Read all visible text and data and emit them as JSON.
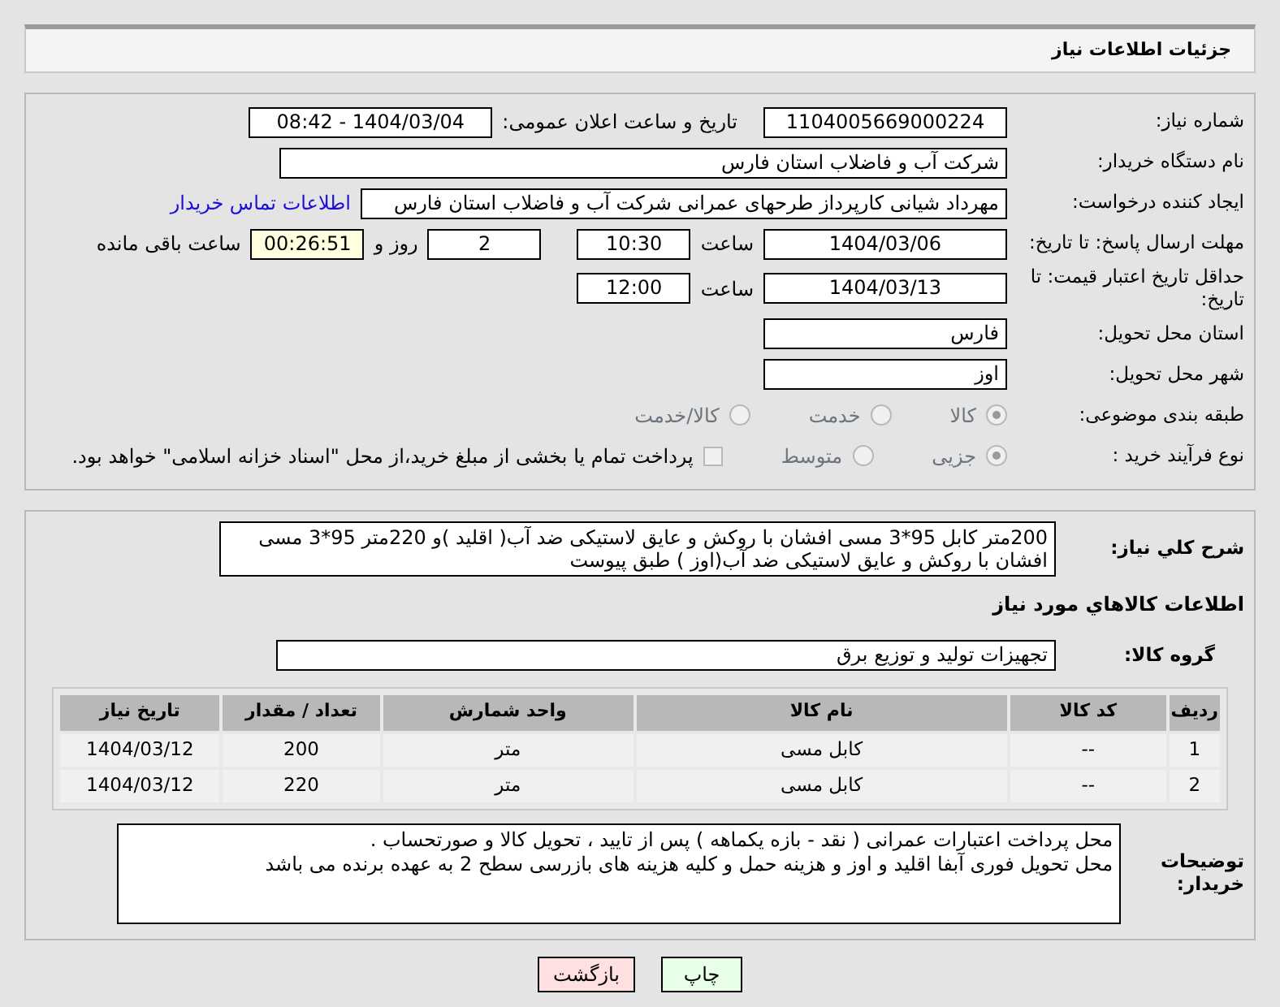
{
  "header": {
    "title": "جزئیات اطلاعات نیاز"
  },
  "need_number": {
    "label": "شماره نیاز:",
    "value": "1104005669000224"
  },
  "announce": {
    "label": "تاریخ و ساعت اعلان عمومی:",
    "value": "1404/03/04 - 08:42"
  },
  "buyer": {
    "label": "نام دستگاه خریدار:",
    "value": "شرکت آب و فاضلاب استان فارس"
  },
  "creator": {
    "label": "ایجاد کننده درخواست:",
    "value": "مهرداد شیانی کارپرداز طرحهای عمرانی  شرکت آب و فاضلاب استان فارس",
    "link": "اطلاعات تماس خریدار"
  },
  "reply_deadline": {
    "label": "مهلت ارسال پاسخ: تا تاریخ:",
    "date": "1404/03/06",
    "time_label": "ساعت",
    "time": "10:30",
    "days": "2",
    "days_label": "روز و",
    "remaining": "00:26:51",
    "remaining_label": "ساعت باقی مانده"
  },
  "price_validity": {
    "label": "حداقل تاریخ اعتبار قیمت: تا تاریخ:",
    "date": "1404/03/13",
    "time_label": "ساعت",
    "time": "12:00"
  },
  "province": {
    "label": "استان محل تحویل:",
    "value": "فارس"
  },
  "city": {
    "label": "شهر محل تحویل:",
    "value": "اوز"
  },
  "category": {
    "label": "طبقه بندی موضوعی:",
    "options": [
      {
        "label": "کالا",
        "selected": true
      },
      {
        "label": "خدمت",
        "selected": false
      },
      {
        "label": "کالا/خدمت",
        "selected": false
      }
    ]
  },
  "process": {
    "label": "نوع فرآیند خرید :",
    "options": [
      {
        "label": "جزیی",
        "selected": true
      },
      {
        "label": "متوسط",
        "selected": false
      }
    ],
    "checkbox": {
      "label": "پرداخت تمام یا بخشی از مبلغ خرید،از محل \"اسناد خزانه اسلامی\" خواهد بود.",
      "checked": false
    }
  },
  "description": {
    "label": "شرح کلي نياز:",
    "value": "200متر کابل 95*3 مسی افشان با روکش و عایق لاستیکی ضد آب( اقلید )و 220متر 95*3 مسی افشان با روکش و عایق لاستیکی ضد آب(اوز ) طبق پیوست"
  },
  "goods_title": "اطلاعات کالاهاي مورد نياز",
  "goods_group": {
    "label": "گروه کالا:",
    "value": "تجهیزات تولید و توزیع برق"
  },
  "table": {
    "columns": [
      "ردیف",
      "کد کالا",
      "نام کالا",
      "واحد شمارش",
      "تعداد / مقدار",
      "تاریخ نیاز"
    ],
    "rows": [
      [
        "1",
        "--",
        "کابل مسی",
        "متر",
        "200",
        "1404/03/12"
      ],
      [
        "2",
        "--",
        "کابل مسی",
        "متر",
        "220",
        "1404/03/12"
      ]
    ]
  },
  "notes": {
    "label": "توضیحات خریدار:",
    "lines": [
      "محل پرداخت اعتبارات عمرانی ( نقد - بازه یکماهه ) پس از تایید ، تحویل کالا و صورتحساب .",
      "محل تحویل فوری آبفا اقلید و اوز  و هزینه حمل و کلیه هزینه های بازرسی سطح 2 به عهده برنده می باشد"
    ]
  },
  "buttons": [
    {
      "label": "چاپ",
      "kind": "print"
    },
    {
      "label": "بازگشت",
      "kind": "back"
    }
  ]
}
